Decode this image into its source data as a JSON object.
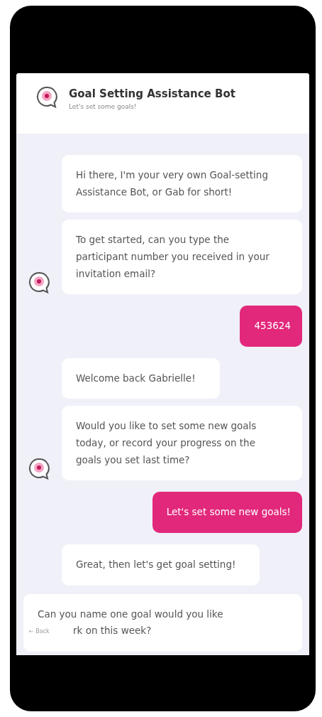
{
  "header": {
    "title": "Goal Setting Assistance Bot",
    "subtitle": "Let's set some goals!"
  },
  "messages": [
    {
      "kind": "bot",
      "avatar": false,
      "lines": [
        "Hi there, I'm your very own Goal-setting Assistance Bot, or Gab for short!"
      ]
    },
    {
      "kind": "bot",
      "avatar": true,
      "lines": [
        "To get started, can you type the participant number you received in your invitation email?"
      ]
    },
    {
      "kind": "user",
      "lines": [
        "453624"
      ]
    },
    {
      "kind": "bot",
      "avatar": false,
      "lines": [
        "Welcome back Gabrielle!"
      ]
    },
    {
      "kind": "bot",
      "avatar": true,
      "lines": [
        "Would you like to set some new goals today, or record your progress on the goals you set last time?"
      ]
    },
    {
      "kind": "user",
      "lines": [
        "Let's set some new goals!"
      ]
    },
    {
      "kind": "bot",
      "avatar": false,
      "lines": [
        "Great, then let's get goal setting!"
      ]
    },
    {
      "kind": "bot-wide",
      "lines": [
        "Can you name one goal would you like",
        "rk on this week?"
      ]
    }
  ],
  "back_link": {
    "arrow": "←",
    "label": "Back"
  }
}
